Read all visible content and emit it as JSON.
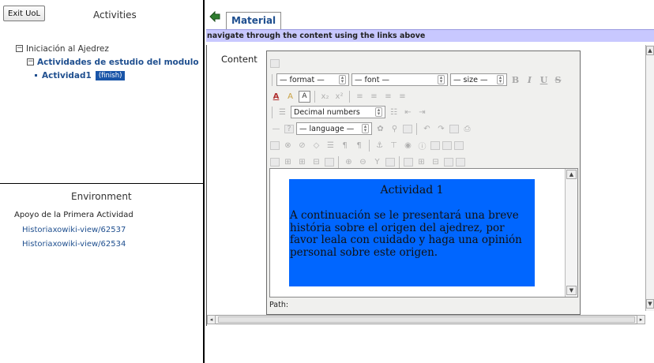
{
  "left": {
    "exit_label": "Exit UoL",
    "activities_title": "Activities",
    "tree": {
      "root": "Iniciación al Ajedrez",
      "sub": "Actividades de estudio del modulo",
      "leaf": "Actividad1",
      "leaf_badge": "(finish)"
    },
    "environment": {
      "title": "Environment",
      "heading": "Apoyo de la Primera Actividad",
      "links": [
        "Historiaxowiki-view/62537",
        "Historiaxowiki-view/62534"
      ]
    }
  },
  "right": {
    "tab_label": "Material",
    "nav_text": "navigate through the content using the links above",
    "content_label": "Content",
    "editor": {
      "format_select": "— format —",
      "font_select": "— font —",
      "size_select": "— size —",
      "list_select": "Decimal numbers",
      "language_select": "— language —",
      "bold": "B",
      "italic": "I",
      "underline": "U",
      "strike": "S",
      "path_label": "Path:"
    },
    "activity": {
      "title": "Actividad 1",
      "body": "A continuación se le presentará una breve história sobre el origen del ajedrez, por favor leala con cuidado y haga una opinión personal sobre este origen."
    }
  },
  "colors": {
    "activity_bg": "#0066ff",
    "nav_bar_bg": "#c8c8ff",
    "link": "#1f4f8f",
    "finish_badge": "#1a55a8"
  }
}
